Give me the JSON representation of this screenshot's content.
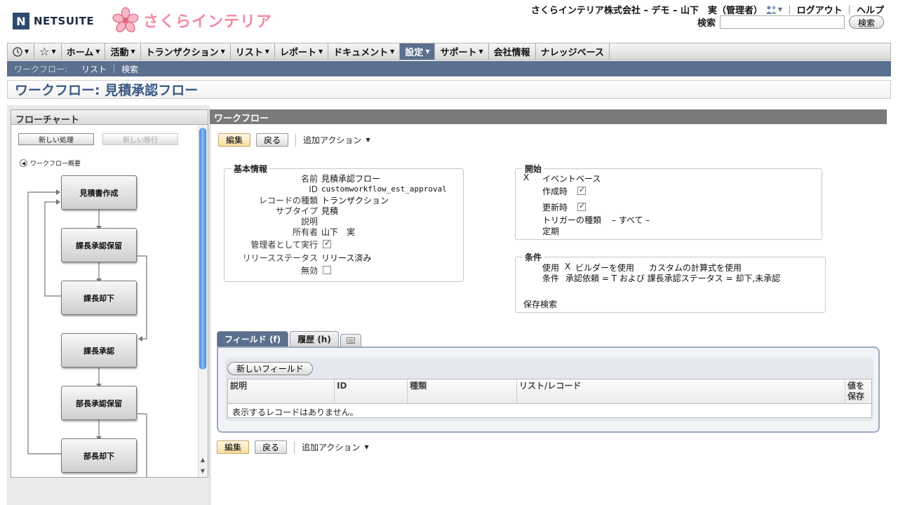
{
  "header": {
    "logo_text": "NETSUITE",
    "logo_mark": "N",
    "brand_name": "さくらインテリア",
    "user": "さくらインテリア株式会社 – デモ – 山下　実（管理者）",
    "logout": "ログアウト",
    "help": "ヘルプ",
    "search_label": "検索",
    "search_value": "",
    "search_button": "検索"
  },
  "nav": {
    "items": [
      {
        "label": "ホーム"
      },
      {
        "label": "活動"
      },
      {
        "label": "トランザクション"
      },
      {
        "label": "リスト"
      },
      {
        "label": "レポート"
      },
      {
        "label": "ドキュメント"
      },
      {
        "label": "設定"
      },
      {
        "label": "サポート"
      },
      {
        "label": "会社情報"
      },
      {
        "label": "ナレッジベース"
      }
    ],
    "active": "設定"
  },
  "subnav": {
    "section": "ワークフロー:",
    "list": "リスト",
    "search": "検索"
  },
  "page_title": "ワークフロー: 見積承認フロー",
  "left_panel": {
    "title": "フローチャート",
    "new_state_button": "新しい処理",
    "new_transition_button": "新しい移行",
    "summary_link": "ワークフロー概要",
    "nodes": [
      "見積書作成",
      "課長承認保留",
      "課長却下",
      "課長承認",
      "部長承認保留",
      "部長却下"
    ]
  },
  "right_panel": {
    "title": "ワークフロー",
    "edit_button": "編集",
    "back_button": "戻る",
    "more_actions": "追加アクション",
    "basic_info": {
      "legend": "基本情報",
      "name_label": "名前",
      "name_value": "見積承認フロー",
      "id_label": "ID",
      "id_value": "customworkflow_est_approval",
      "record_type_label": "レコードの種類",
      "record_type_value": "トランザクション",
      "subtype_label": "サブタイプ",
      "subtype_value": "見積",
      "description_label": "説明",
      "owner_label": "所有者",
      "owner_value": "山下　実",
      "run_as_admin_label": "管理者として実行",
      "release_status_label": "リリースステータス",
      "release_status_value": "リリース済み",
      "inactive_label": "無効"
    },
    "start": {
      "legend": "開始",
      "x_mark": "X",
      "event_based": "イベントベース",
      "on_create": "作成時",
      "on_update": "更新時",
      "trigger_type_label": "トリガーの種類",
      "trigger_type_value": "– すべて –",
      "scheduled": "定期"
    },
    "conditions": {
      "legend": "条件",
      "use_label": "使用",
      "use_x": "X",
      "use_builder": "ビルダーを使用",
      "use_formula": "カスタムの計算式を使用",
      "condition_label": "条件",
      "condition_value": "承認依頼 = T および 課長承認ステータス = 却下,未承認",
      "saved_search": "保存検索"
    },
    "tabs": {
      "fields": "フィールド (f)",
      "history": "履歴 (h)"
    },
    "new_field_button": "新しいフィールド",
    "grid": {
      "columns": [
        "説明",
        "ID",
        "種類",
        "リスト/レコード",
        "値を保存"
      ],
      "empty": "表示するレコードはありません。"
    }
  }
}
